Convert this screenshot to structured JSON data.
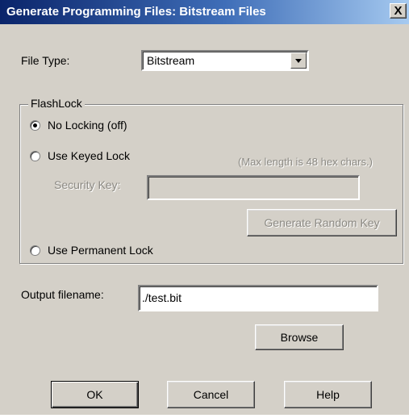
{
  "window": {
    "title": "Generate Programming Files: Bitstream Files",
    "close_glyph": "X"
  },
  "file_type": {
    "label": "File Type:",
    "value": "Bitstream"
  },
  "flashlock": {
    "group_label": "FlashLock",
    "options": [
      {
        "label": "No Locking (off)",
        "selected": true
      },
      {
        "label": "Use Keyed Lock",
        "selected": false
      },
      {
        "label": "Use Permanent Lock",
        "selected": false
      }
    ],
    "max_length_note": "(Max length is 48 hex chars.)",
    "security_key_label": "Security Key:",
    "security_key_value": "",
    "generate_key_button": "Generate Random Key"
  },
  "output": {
    "label": "Output filename:",
    "value": "./test.bit",
    "browse_button": "Browse"
  },
  "buttons": {
    "ok": "OK",
    "cancel": "Cancel",
    "help": "Help"
  }
}
